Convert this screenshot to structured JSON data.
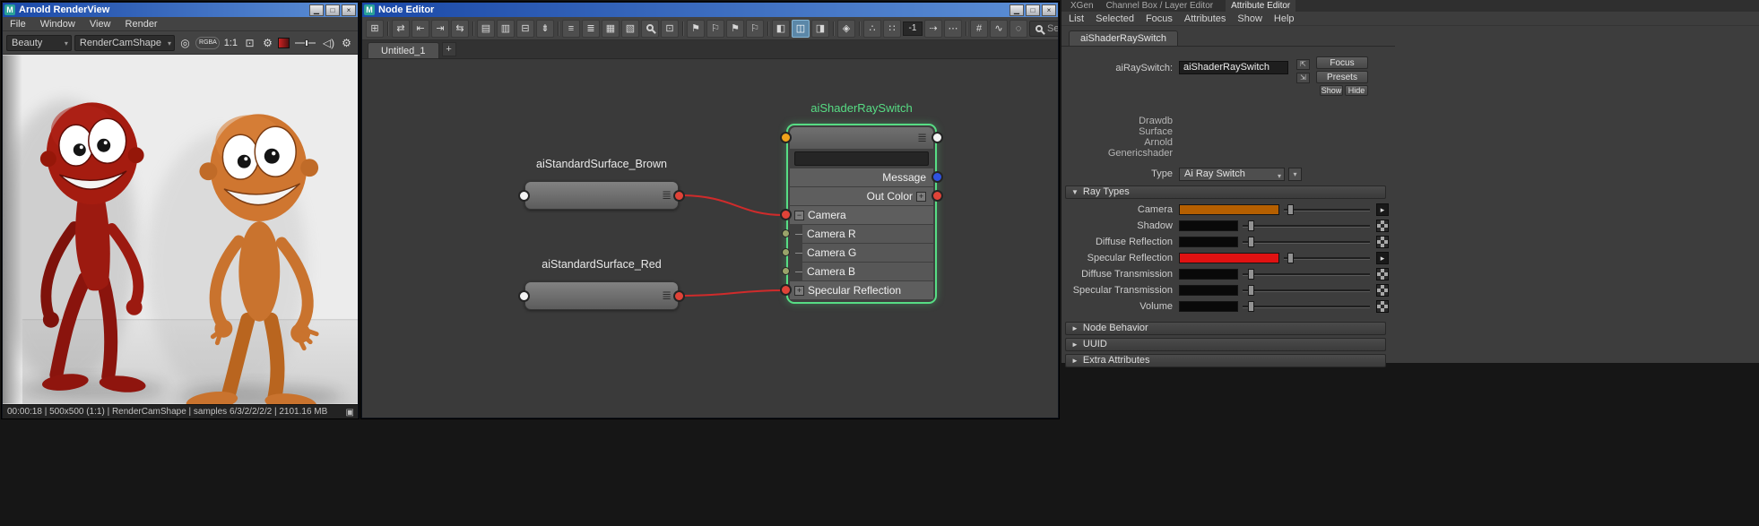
{
  "colors": {
    "titlebar-a": "#1b49a8",
    "titlebar-b": "#5c8fd6",
    "node-green": "#57dd84",
    "wire-red": "#cf2b2b",
    "icon-active": "#5b87a8",
    "camera-orange": "#b55f00",
    "specular-red": "#e01212",
    "char-red": "#9c1a10",
    "char-orange": "#c9732e"
  },
  "glyphs": {
    "maya": "M",
    "window_min": "▁",
    "window_max": "□",
    "window_close": "×",
    "combo_arrow": "▾",
    "menu": "≣",
    "plus": "+",
    "minus": "−",
    "map_arrow": "▸",
    "section_open": "▼",
    "section_closed": "►",
    "tearoff_a": "⇱",
    "tearoff_b": "⇲",
    "console": "▣",
    "tab_add": "+"
  },
  "render_view": {
    "title": "Arnold RenderView",
    "menus": [
      "File",
      "Window",
      "View",
      "Render"
    ],
    "toolbar": {
      "aov": "Beauty",
      "camera": "RenderCamShape",
      "ratio": "1:1",
      "icons": [
        {
          "name": "snapshot-target-icon",
          "glyph": "◎"
        },
        {
          "name": "rgba-channels-icon",
          "glyph": "RGBA"
        },
        {
          "name": "crop-region-icon",
          "glyph": "⊡"
        },
        {
          "name": "settings-gear-icon",
          "glyph": "⚙"
        },
        {
          "name": "speaker-icon",
          "glyph": "◁)"
        },
        {
          "name": "render-gear-icon",
          "glyph": "⚙"
        }
      ]
    },
    "status": "00:00:18 | 500x500 (1:1) | RenderCamShape | samples 6/3/2/2/2/2 | 2101.16 MB"
  },
  "node_editor": {
    "title": "Node Editor",
    "tabs": {
      "active": "Untitled_1"
    },
    "toolbar": {
      "grid_size": "-1",
      "search_placeholder": "Search...",
      "icons": [
        {
          "name": "add-node-icon",
          "glyph": "⊞"
        },
        {
          "name": "connect-mode-icon",
          "glyph": "⇄"
        },
        {
          "name": "input-connections-icon",
          "glyph": "⇤"
        },
        {
          "name": "output-connections-icon",
          "glyph": "⇥"
        },
        {
          "name": "all-connections-icon",
          "glyph": "⇆"
        },
        {
          "name": "add-to-graph-icon",
          "glyph": "▤"
        },
        {
          "name": "remove-from-graph-icon",
          "glyph": "▥"
        },
        {
          "name": "clear-graph-icon",
          "glyph": "⊟"
        },
        {
          "name": "pin-icon",
          "glyph": "⇟"
        },
        {
          "name": "align-horizontal-icon",
          "glyph": "≡"
        },
        {
          "name": "align-vertical-icon",
          "glyph": "≣"
        },
        {
          "name": "grid-layout-icon",
          "glyph": "▦"
        },
        {
          "name": "auto-layout-icon",
          "glyph": "▧"
        },
        {
          "name": "frame-all-icon",
          "glyph": "⊡"
        },
        {
          "name": "bookmark-add-icon",
          "glyph": "⚑"
        },
        {
          "name": "bookmark-remove-icon",
          "glyph": "⚐"
        },
        {
          "name": "bookmark-next-icon",
          "glyph": "⚑"
        },
        {
          "name": "bookmark-prev-icon",
          "glyph": "⚐"
        },
        {
          "name": "display-simple-icon",
          "glyph": "◧"
        },
        {
          "name": "display-connected-icon",
          "glyph": "◫"
        },
        {
          "name": "display-full-icon",
          "glyph": "◨"
        },
        {
          "name": "lock-icon",
          "glyph": "◈"
        },
        {
          "name": "snap-dots-icon",
          "glyph": "∴"
        },
        {
          "name": "grid-dots-icon",
          "glyph": "∷"
        },
        {
          "name": "step-icon",
          "glyph": "⇢"
        },
        {
          "name": "spacing-icon",
          "glyph": "⋯"
        },
        {
          "name": "hash-grid-icon",
          "glyph": "#"
        },
        {
          "name": "connection-style-icon",
          "glyph": "∿"
        },
        {
          "name": "crosshair-icon",
          "glyph": "◌"
        }
      ]
    },
    "graph": {
      "brown_node": {
        "label": "aiStandardSurface_Brown"
      },
      "red_node": {
        "label": "aiStandardSurface_Red"
      },
      "switch_node": {
        "title": "aiShaderRaySwitch",
        "outputs": [
          {
            "label": "Message"
          },
          {
            "label": "Out Color"
          }
        ],
        "inputs": [
          {
            "label": "Camera"
          },
          {
            "label": "Camera R"
          },
          {
            "label": "Camera G"
          },
          {
            "label": "Camera B"
          },
          {
            "label": "Specular Reflection"
          }
        ]
      }
    }
  },
  "attribute_editor": {
    "panel_tabs": [
      {
        "label": "XGen"
      },
      {
        "label": "Channel Box / Layer Editor"
      },
      {
        "label": "Attribute Editor"
      }
    ],
    "menus": [
      "List",
      "Selected",
      "Focus",
      "Attributes",
      "Show",
      "Help"
    ],
    "node_tab": "aiShaderRaySwitch",
    "name_field": {
      "label": "aiRaySwitch:",
      "value": "aiShaderRaySwitch"
    },
    "buttons": {
      "focus": "Focus",
      "presets": "Presets",
      "show": "Show",
      "hide": "Hide"
    },
    "classification": [
      "Drawdb",
      "Surface",
      "Arnold",
      "Genericshader"
    ],
    "type_row": {
      "label": "Type",
      "value": "Ai Ray Switch"
    },
    "sections": [
      {
        "title": "Ray Types",
        "expanded": true
      },
      {
        "title": "Node Behavior",
        "expanded": false
      },
      {
        "title": "UUID",
        "expanded": false
      },
      {
        "title": "Extra Attributes",
        "expanded": false
      }
    ],
    "ray_rows": [
      {
        "label": "Camera",
        "color": "#b55f00",
        "connected": true,
        "slider_pct": 4
      },
      {
        "label": "Shadow",
        "color": "#090909",
        "connected": false,
        "slider_pct": 4
      },
      {
        "label": "Diffuse Reflection",
        "color": "#090909",
        "connected": false,
        "slider_pct": 4
      },
      {
        "label": "Specular Reflection",
        "color": "#e01212",
        "connected": true,
        "slider_pct": 4
      },
      {
        "label": "Diffuse Transmission",
        "color": "#090909",
        "connected": false,
        "slider_pct": 4
      },
      {
        "label": "Specular Transmission",
        "color": "#090909",
        "connected": false,
        "slider_pct": 4
      },
      {
        "label": "Volume",
        "color": "#090909",
        "connected": false,
        "slider_pct": 4
      }
    ]
  }
}
